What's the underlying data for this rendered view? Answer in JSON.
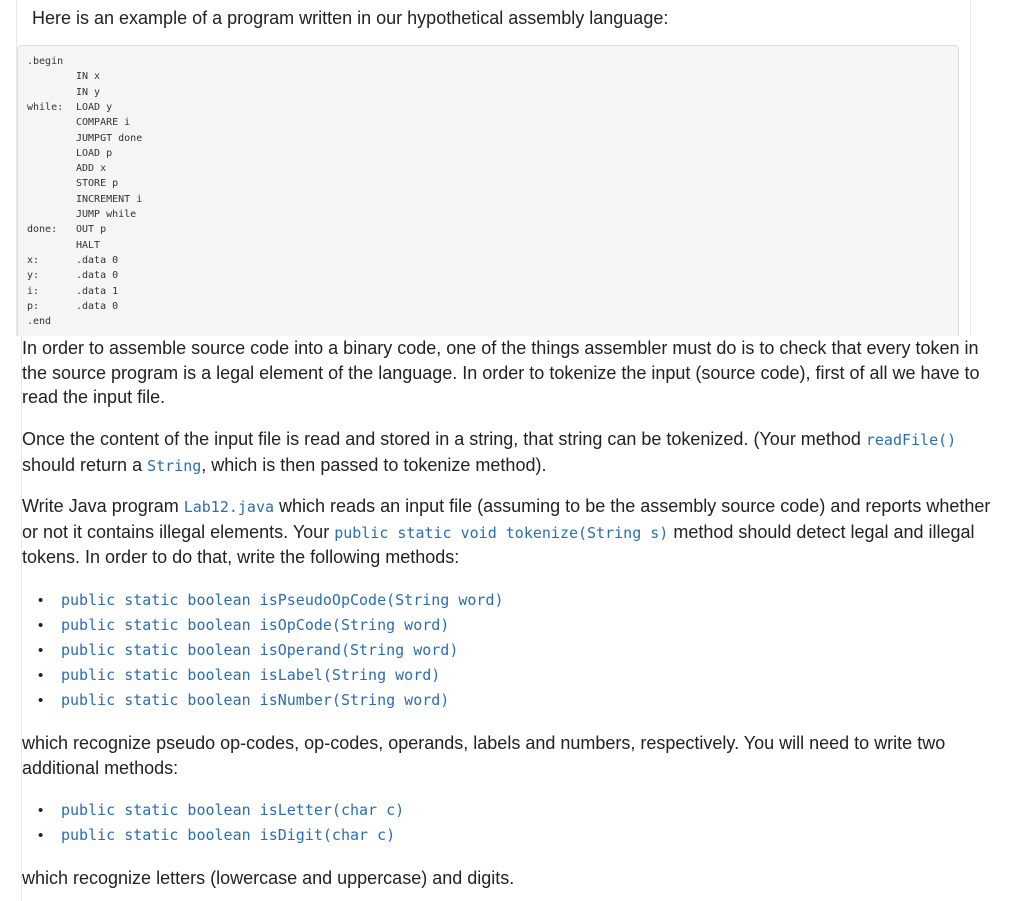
{
  "intro_text": "Here is an example of a program written in our hypothetical assembly language:",
  "code_lines": [
    {
      "label": ".begin",
      "code": ""
    },
    {
      "label": "",
      "code": "IN x"
    },
    {
      "label": "",
      "code": "IN y"
    },
    {
      "label": "while:",
      "code": "LOAD y"
    },
    {
      "label": "",
      "code": "COMPARE i"
    },
    {
      "label": "",
      "code": "JUMPGT done"
    },
    {
      "label": "",
      "code": "LOAD p"
    },
    {
      "label": "",
      "code": "ADD x"
    },
    {
      "label": "",
      "code": "STORE p"
    },
    {
      "label": "",
      "code": "INCREMENT i"
    },
    {
      "label": "",
      "code": "JUMP while"
    },
    {
      "label": "done:",
      "code": "OUT p"
    },
    {
      "label": "",
      "code": "HALT"
    },
    {
      "label": "x:",
      "code": ".data 0"
    },
    {
      "label": "y:",
      "code": ".data 0"
    },
    {
      "label": "i:",
      "code": ".data 1"
    },
    {
      "label": "p:",
      "code": ".data 0"
    },
    {
      "label": ".end",
      "code": ""
    }
  ],
  "para1": "In order to assemble source code into a binary code, one of the things assembler must do is to check that every token in the source program is a legal element of the language. In order to tokenize the input (source code), first of all we have to read the input file.",
  "para2": {
    "part1": "Once the content of the input file is read and stored in a string, that string can be tokenized. (Your method ",
    "code1": "readFile()",
    "part2": " should return a ",
    "code2": "String",
    "part3": ", which is then passed to tokenize method)."
  },
  "para3": {
    "part1": "Write Java program ",
    "code1": "Lab12.java",
    "part2": " which reads an input file (assuming to be the assembly source code) and reports whether or not it contains illegal elements. Your ",
    "code2": "public static void tokenize(String s)",
    "part3": " method should detect legal and illegal tokens. In order to do that, write the following methods:"
  },
  "methods1": [
    "public static boolean isPseudoOpCode(String word)",
    "public static boolean isOpCode(String word)",
    "public static boolean isOperand(String word)",
    "public static boolean isLabel(String word)",
    "public static boolean isNumber(String word)"
  ],
  "para4": "which recognize pseudo op-codes, op-codes, operands, labels and numbers, respectively. You will need to write two additional methods:",
  "methods2": [
    "public static boolean isLetter(char c)",
    "public static boolean isDigit(char c)"
  ],
  "para5": "which recognize letters (lowercase and uppercase) and digits."
}
